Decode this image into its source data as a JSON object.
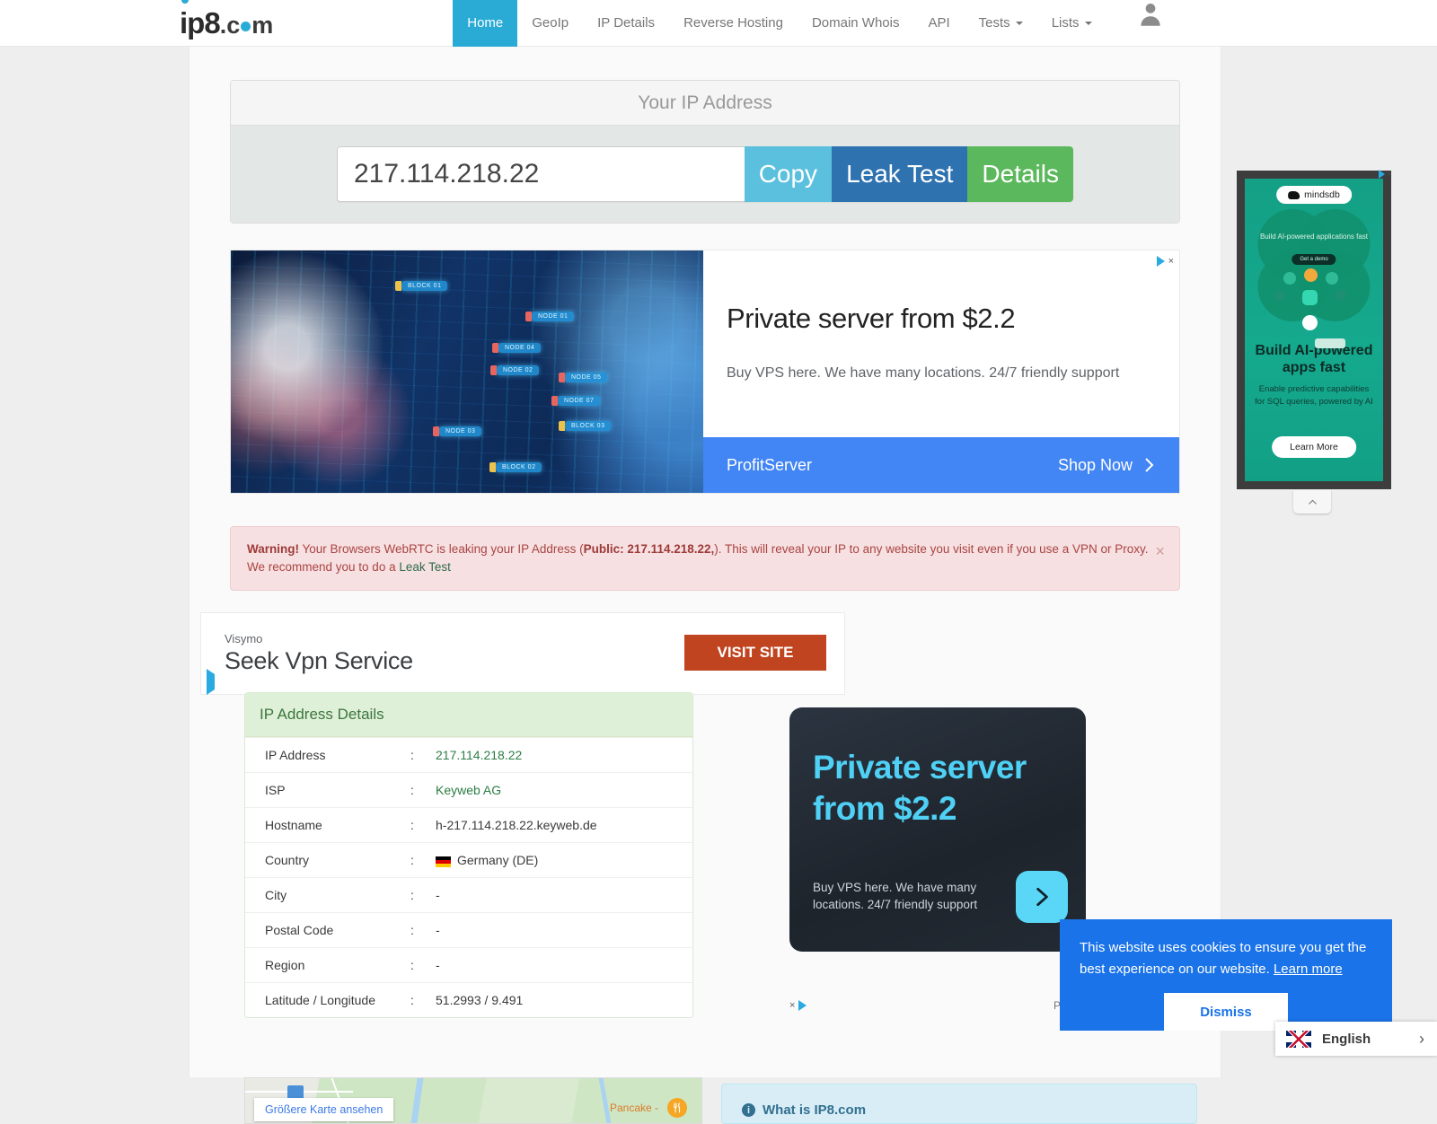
{
  "header": {
    "logo": {
      "prefix": "ip8",
      "suffix": "c",
      "tail": "m",
      "dot": ".",
      "full": "ip8.com"
    },
    "nav": [
      {
        "label": "Home",
        "active": true,
        "dropdown": false
      },
      {
        "label": "GeoIp",
        "active": false,
        "dropdown": false
      },
      {
        "label": "IP Details",
        "active": false,
        "dropdown": false
      },
      {
        "label": "Reverse Hosting",
        "active": false,
        "dropdown": false
      },
      {
        "label": "Domain Whois",
        "active": false,
        "dropdown": false
      },
      {
        "label": "API",
        "active": false,
        "dropdown": false
      },
      {
        "label": "Tests",
        "active": false,
        "dropdown": true
      },
      {
        "label": "Lists",
        "active": false,
        "dropdown": true
      }
    ],
    "account_icon": "user-avatar-icon"
  },
  "ip_panel": {
    "title": "Your IP Address",
    "ip_value": "217.114.218.22",
    "buttons": {
      "copy": "Copy",
      "leak_test": "Leak Test",
      "details": "Details"
    },
    "colors": {
      "copy": "#5bc0de",
      "leak_test": "#2f72b0",
      "details": "#5cb85c"
    }
  },
  "top_ad": {
    "headline": "Private server from $2.2",
    "description": "Buy VPS here. We have many locations. 24/7 friendly support",
    "advertiser": "ProfitServer",
    "cta": "Shop Now",
    "adchoices_label": "AdChoices",
    "close_label": "×",
    "image_nodes": [
      "BLOCK 01",
      "NODE 01",
      "NODE 04",
      "NODE 02",
      "NODE 05",
      "NODE 07",
      "BLOCK 03",
      "BLOCK 02",
      "NODE 03"
    ]
  },
  "warning": {
    "prefix": "Warning!",
    "text_1": " Your Browsers WebRTC is leaking your IP Address (",
    "bold_public": "Public: 217.114.218.22,",
    "text_2": "). This will reveal your IP to any website you visit even if you use a VPN or Proxy. We recommend you to do a ",
    "link": "Leak Test",
    "close": "×"
  },
  "visymo_ad": {
    "brand": "Visymo",
    "headline": "Seek Vpn Service",
    "button": "VISIT SITE"
  },
  "ip_details": {
    "title": "IP Address Details",
    "rows": [
      {
        "key": "IP Address",
        "sep": ":",
        "value": "217.114.218.22",
        "green": true,
        "flag": false
      },
      {
        "key": "ISP",
        "sep": ":",
        "value": "Keyweb AG",
        "green": true,
        "flag": false
      },
      {
        "key": "Hostname",
        "sep": ":",
        "value": "h-217.114.218.22.keyweb.de",
        "green": false,
        "flag": false
      },
      {
        "key": "Country",
        "sep": ":",
        "value": "Germany (DE)",
        "green": false,
        "flag": true
      },
      {
        "key": "City",
        "sep": ":",
        "value": "-",
        "green": false,
        "flag": false
      },
      {
        "key": "Postal Code",
        "sep": ":",
        "value": "-",
        "green": false,
        "flag": false
      },
      {
        "key": "Region",
        "sep": ":",
        "value": "-",
        "green": false,
        "flag": false
      },
      {
        "key": "Latitude / Longitude",
        "sep": ":",
        "value": "51.2993 / 9.491",
        "green": false,
        "flag": false
      }
    ]
  },
  "dark_ad": {
    "headline_line1": "Private server",
    "headline_line2": "from $2.2",
    "description": "Buy VPS here. We have many locations. 24/7 friendly support",
    "advertiser": "ProfitS",
    "arrow_icon": "chevron-right-icon"
  },
  "map": {
    "bigger_map_link": "Größere Karte ansehen",
    "poi_label": "Pancake -",
    "poi_icon": "restaurant-icon"
  },
  "what_is": {
    "title": "What is IP8.com",
    "icon": "info-icon"
  },
  "side_ad": {
    "brand": "mindsdb",
    "inner_headline": "Build AI-powered applications fast",
    "inner_button": "Get a demo",
    "headline_line1": "Build AI-powered",
    "headline_line2": "apps fast",
    "subtext_line1": "Enable predictive capabilities",
    "subtext_line2": "for SQL queries, powered by AI",
    "cta": "Learn More",
    "adchoices_close": "×",
    "collapse_icon": "chevron-up-icon",
    "background_color": "#14a085"
  },
  "cookie_banner": {
    "text": "This website uses cookies to ensure you get the best experience on our website.",
    "learn_more": "Learn more",
    "dismiss": "Dismiss",
    "background_color": "#1a73e8"
  },
  "language": {
    "name": "English",
    "flag": "uk-flag-icon",
    "chevron": "›"
  }
}
